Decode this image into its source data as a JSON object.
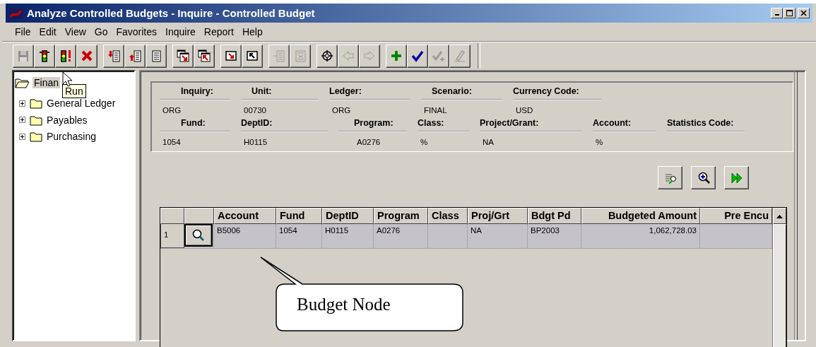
{
  "window": {
    "title": "Analyze Controlled Budgets - Inquire - Controlled Budget"
  },
  "menu": [
    "File",
    "Edit",
    "View",
    "Go",
    "Favorites",
    "Inquire",
    "Report",
    "Help"
  ],
  "toolbar": {
    "groups": [
      [
        {
          "kind": "save",
          "disabled": true
        },
        {
          "kind": "traffic-light",
          "disabled": false
        },
        {
          "kind": "traffic-light-alert",
          "disabled": false
        },
        {
          "kind": "cancel",
          "disabled": false
        }
      ],
      [
        {
          "kind": "insert-down",
          "disabled": false
        },
        {
          "kind": "insert-up",
          "disabled": false
        },
        {
          "kind": "list",
          "disabled": false
        }
      ],
      [
        {
          "kind": "window-down",
          "disabled": false
        },
        {
          "kind": "window-up",
          "disabled": false
        }
      ],
      [
        {
          "kind": "arrow-down",
          "disabled": false
        },
        {
          "kind": "arrow-up",
          "disabled": false
        }
      ],
      [
        {
          "kind": "row-insert",
          "disabled": true
        },
        {
          "kind": "row-delete",
          "disabled": true
        }
      ],
      [
        {
          "kind": "target",
          "disabled": false
        },
        {
          "kind": "back",
          "disabled": true
        },
        {
          "kind": "forward",
          "disabled": true
        }
      ],
      [
        {
          "kind": "add",
          "disabled": false
        },
        {
          "kind": "check",
          "disabled": false
        },
        {
          "kind": "check-add",
          "disabled": true
        },
        {
          "kind": "edit",
          "disabled": true
        }
      ]
    ]
  },
  "tooltip": "Run",
  "tree": {
    "items": [
      {
        "label": "Finan",
        "selected": true,
        "children": [
          {
            "label": "General Ledger",
            "selected": false,
            "expanded": false
          },
          {
            "label": "Payables",
            "selected": false,
            "expanded": false
          },
          {
            "label": "Purchasing",
            "selected": false,
            "expanded": false
          }
        ]
      }
    ]
  },
  "header": {
    "rows": [
      [
        {
          "label": "Inquiry:",
          "value": "ORG"
        },
        {
          "label": "Unit:",
          "value": "00730"
        },
        {
          "label": "Ledger:",
          "value": "ORG"
        },
        {
          "label": "Scenario:",
          "value": "FINAL"
        },
        {
          "label": "Currency Code:",
          "value": "USD"
        }
      ],
      [
        {
          "label": "Fund:",
          "value": "1054"
        },
        {
          "label": "DeptID:",
          "value": "H0115"
        },
        {
          "label": "Program:",
          "value": "A0276"
        },
        {
          "label": "Class:",
          "value": "%"
        },
        {
          "label": "Project/Grant:",
          "value": "NA"
        },
        {
          "label": "Account:",
          "value": "%"
        },
        {
          "label": "Statistics Code:"
        }
      ]
    ]
  },
  "grid_buttons": [
    {
      "kind": "find"
    },
    {
      "kind": "zoom"
    },
    {
      "kind": "next"
    }
  ],
  "table": {
    "columns": [
      {
        "kind": "number"
      },
      {
        "kind": "lookup"
      },
      {
        "label": "Account"
      },
      {
        "label": "Fund"
      },
      {
        "label": "DeptID"
      },
      {
        "label": "Program"
      },
      {
        "label": "Class"
      },
      {
        "label": "Proj/Grt"
      },
      {
        "label": "Bdgt Pd"
      },
      {
        "label": "Budgeted Amount"
      },
      {
        "label": "Pre Encu"
      }
    ],
    "rows": [
      {
        "selected": true,
        "cells": [
          "1",
          null,
          "B5006",
          "1054",
          "H0115",
          "A0276",
          null,
          "NA",
          "BP2003",
          "1,062,728.03",
          null
        ]
      }
    ]
  },
  "callout": {
    "text": "Budget Node"
  }
}
